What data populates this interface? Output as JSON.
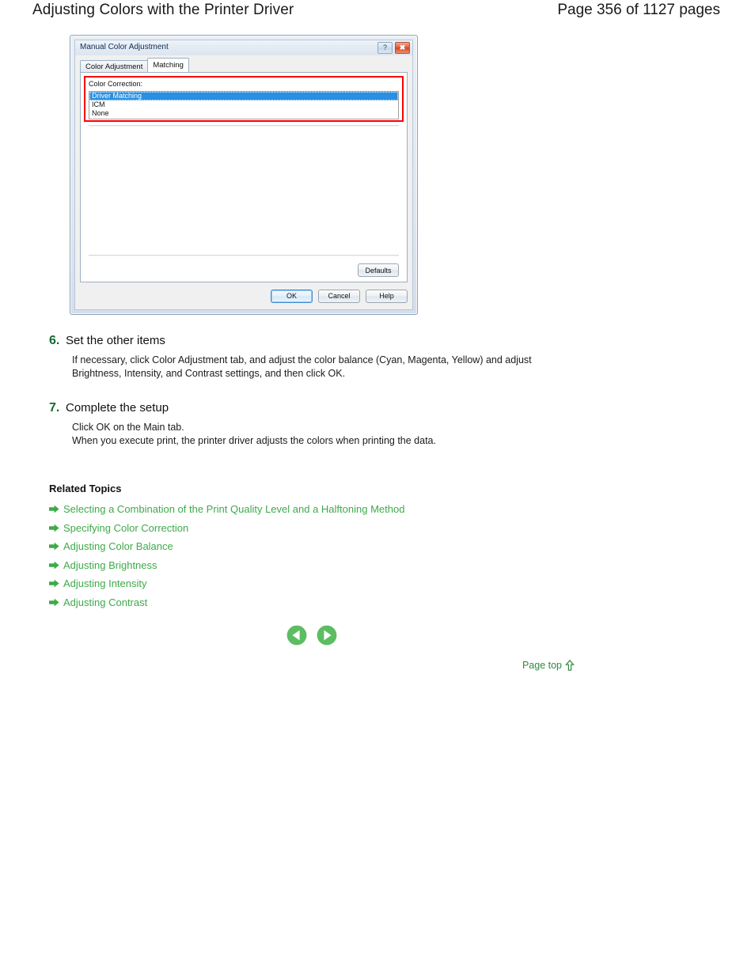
{
  "header": {
    "doc_title": "Adjusting Colors with the Printer Driver",
    "page_count": "Page 356 of 1127 pages"
  },
  "dialog": {
    "title": "Manual Color Adjustment",
    "window_buttons": [
      {
        "name": "help-button",
        "glyph": "?"
      },
      {
        "name": "close-button",
        "glyph": "✖"
      }
    ],
    "tabs": [
      {
        "label": "Color Adjustment",
        "active": false
      },
      {
        "label": "Matching",
        "active": true
      }
    ],
    "field_label": "Color Correction:",
    "options": [
      {
        "label": "Driver Matching",
        "selected": true
      },
      {
        "label": "ICM",
        "selected": false
      },
      {
        "label": "None",
        "selected": false
      }
    ],
    "defaults_label": "Defaults",
    "footer_buttons": [
      {
        "label": "OK",
        "focused": true
      },
      {
        "label": "Cancel",
        "focused": false
      },
      {
        "label": "Help",
        "focused": false
      }
    ],
    "highlight_color": "#fb0000",
    "selection_color": "#2a8fe0"
  },
  "steps": [
    {
      "number": "6.",
      "title": "Set the other items",
      "body": "If necessary, click Color Adjustment tab, and adjust the color balance (Cyan, Magenta, Yellow) and adjust Brightness, Intensity, and Contrast settings, and then click OK."
    },
    {
      "number": "7.",
      "title": "Complete the setup",
      "body": "Click OK on the Main tab.\nWhen you execute print, the printer driver adjusts the colors when printing the data."
    }
  ],
  "related": {
    "title": "Related Topics",
    "links": [
      "Selecting a Combination of the Print Quality Level and a Halftoning Method",
      "Specifying Color Correction",
      "Adjusting Color Balance",
      "Adjusting Brightness",
      "Adjusting Intensity",
      "Adjusting Contrast"
    ],
    "link_color": "#3eaa49"
  },
  "navigation": {
    "previous_icon": "previous-page-icon",
    "next_icon": "next-page-icon",
    "page_top_label": "Page top",
    "page_top_icon": "up-arrow-icon",
    "accent_color": "#5cbd62"
  }
}
